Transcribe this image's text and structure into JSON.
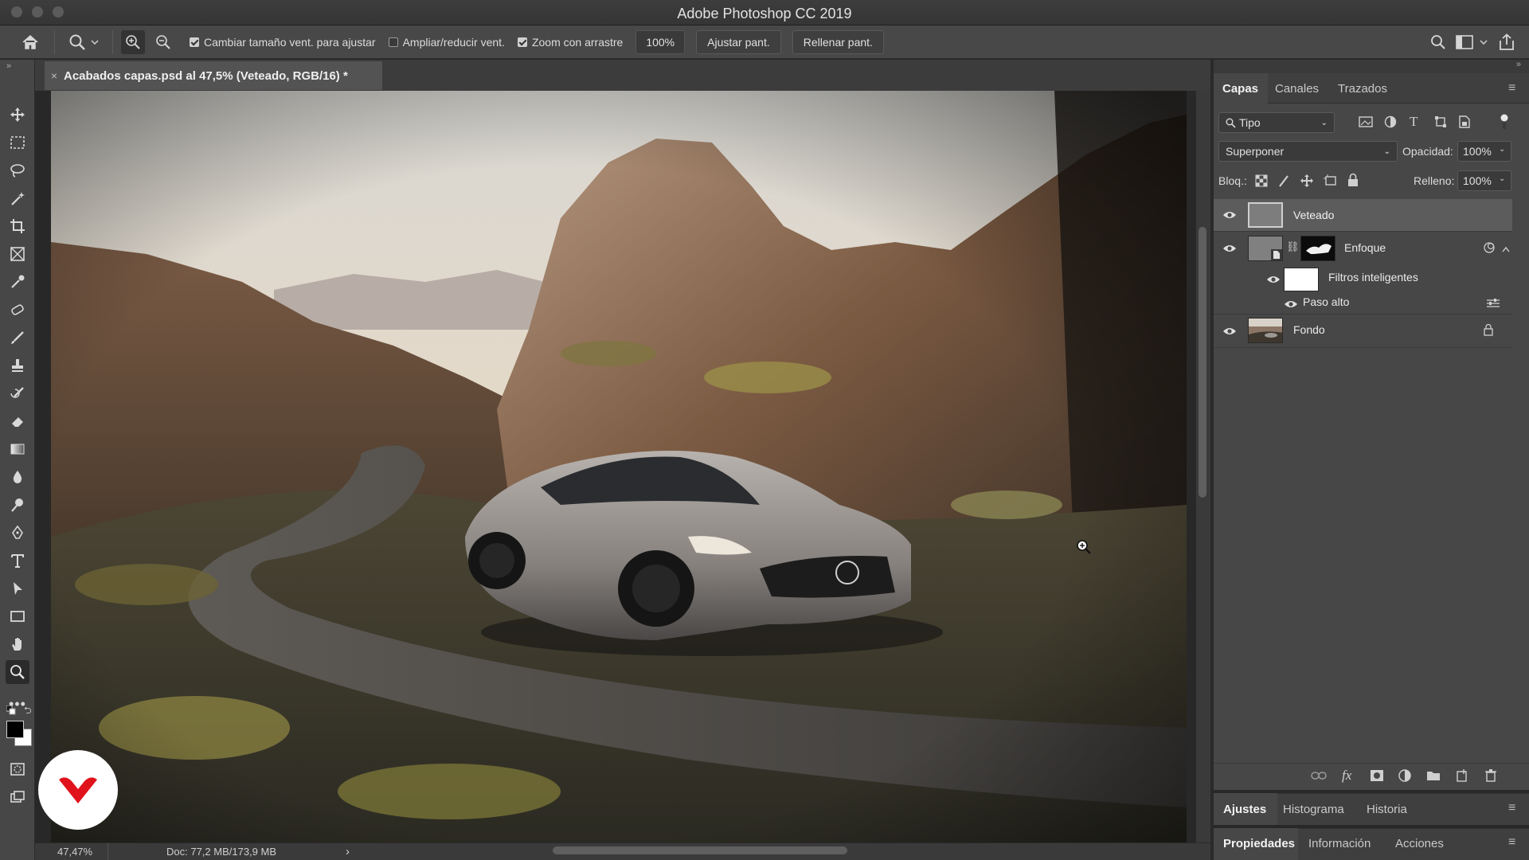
{
  "window": {
    "title": "Adobe Photoshop CC 2019"
  },
  "options_bar": {
    "resize_windows_label": "Cambiar tamaño vent. para ajustar",
    "resize_windows_checked": true,
    "zoom_all_windows_label": "Ampliar/reducir vent.",
    "zoom_all_windows_checked": false,
    "scrubby_zoom_label": "Zoom con arrastre",
    "scrubby_zoom_checked": true,
    "zoom_value": "100%",
    "fit_screen_label": "Ajustar pant.",
    "fill_screen_label": "Rellenar pant."
  },
  "document": {
    "tab_title": "Acabados capas.psd al 47,5% (Veteado, RGB/16) *",
    "close_glyph": "×"
  },
  "status": {
    "zoom": "47,47%",
    "doc_info": "Doc: 77,2 MB/173,9 MB",
    "arrow": "›"
  },
  "layers_panel": {
    "tabs": [
      "Capas",
      "Canales",
      "Trazados"
    ],
    "active_tab": "Capas",
    "filter_label": "Tipo",
    "blend_mode": "Superponer",
    "opacity_label": "Opacidad:",
    "opacity_value": "100%",
    "lock_label": "Bloq.:",
    "fill_label": "Relleno:",
    "fill_value": "100%",
    "layers": [
      {
        "name": "Veteado",
        "visible": true,
        "selected": true
      },
      {
        "name": "Enfoque",
        "visible": true,
        "smart_object": true
      },
      {
        "name": "Filtros inteligentes",
        "visible": true,
        "sublayer": true
      },
      {
        "name": "Paso alto",
        "visible": true,
        "filter": true
      },
      {
        "name": "Fondo",
        "visible": true,
        "locked": true
      }
    ]
  },
  "adjustments_panel": {
    "tabs": [
      "Ajustes",
      "Histograma",
      "Historia"
    ],
    "active_tab": "Ajustes"
  },
  "properties_panel": {
    "tabs": [
      "Propiedades",
      "Información",
      "Acciones"
    ],
    "active_tab": "Propiedades"
  },
  "colors": {
    "foreground": "#000000",
    "background": "#ffffff",
    "logo_red": "#e0121b"
  }
}
